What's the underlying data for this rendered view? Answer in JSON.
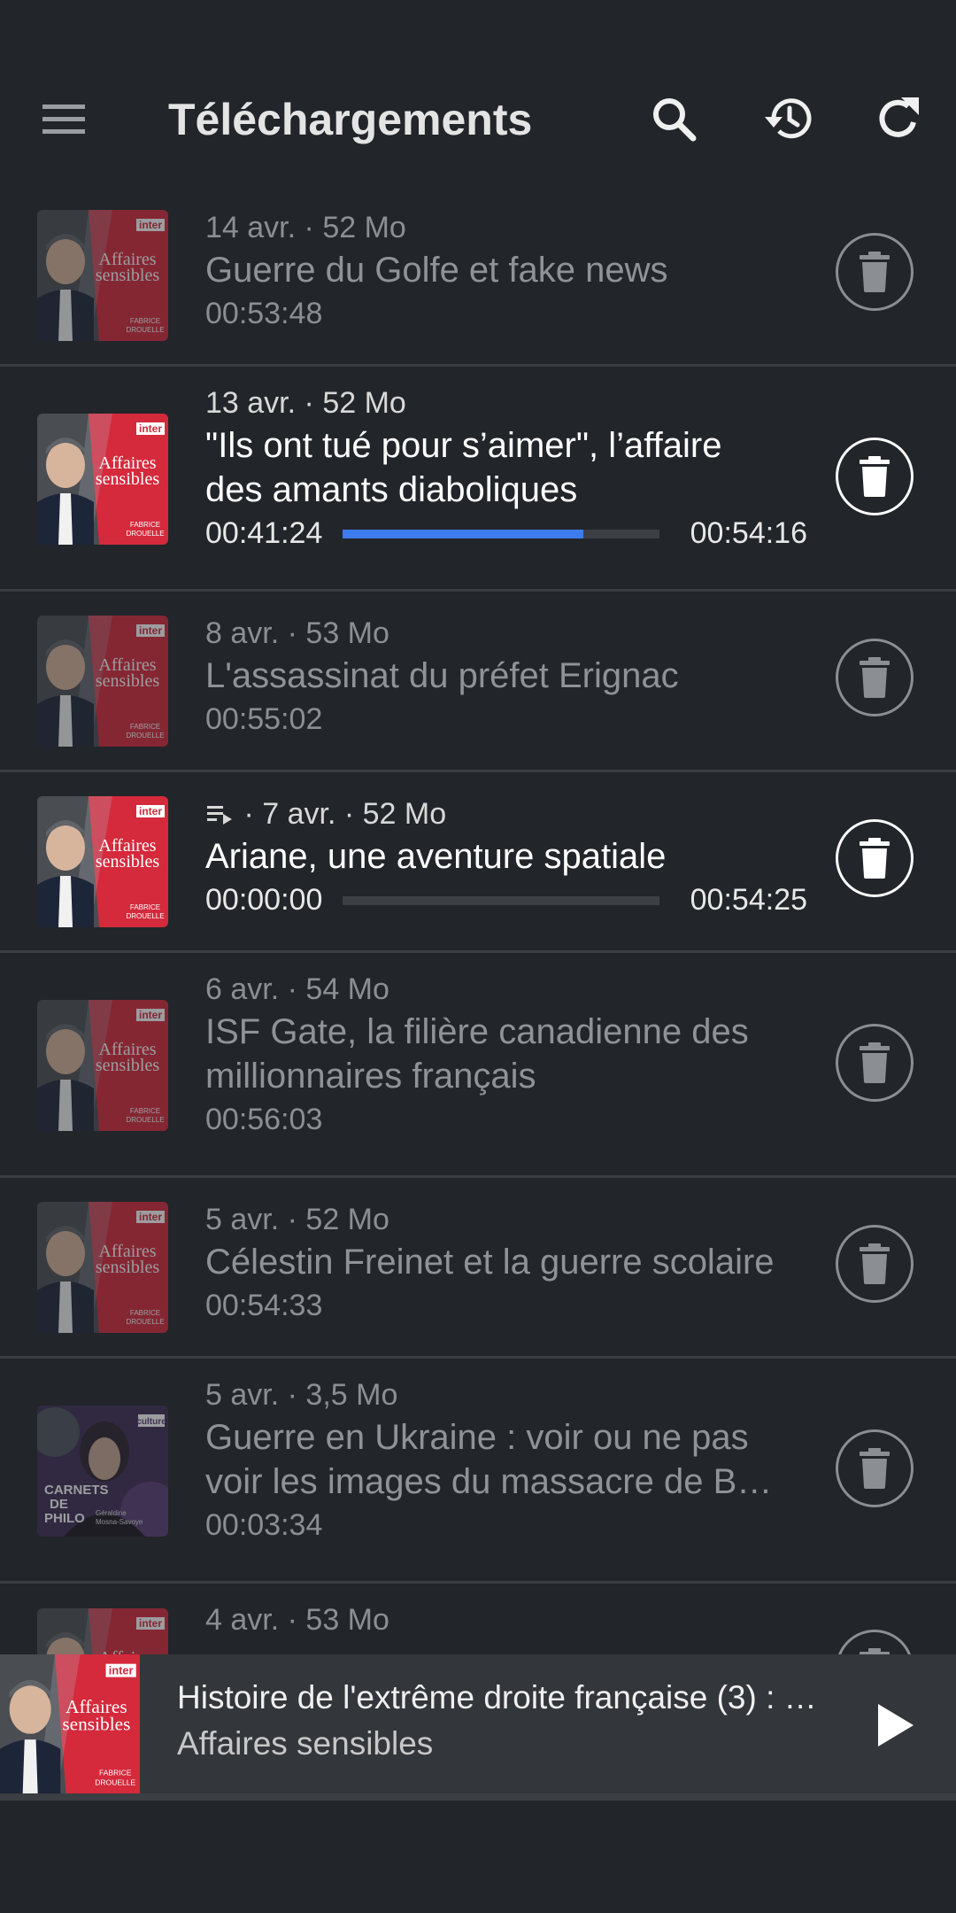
{
  "appbar": {
    "title": "Téléchargements",
    "menu_icon": "menu-icon",
    "search_icon": "search-icon",
    "history_icon": "history-icon",
    "refresh_icon": "refresh-icon"
  },
  "colors": {
    "background": "#22252a",
    "divider": "#3a3d42",
    "accent_progress": "#3d7bef",
    "muted_text": "#8b8e93",
    "cover_red": "#d42a3c",
    "cover_purple": "#5b3a78"
  },
  "episodes": [
    {
      "date": "14 avr.",
      "size": "52 Mo",
      "title": "Guerre du Golfe et fake news",
      "duration": "00:53:48",
      "cover": {
        "brand": "inter",
        "l1": "Affaires",
        "l2": "sensibles",
        "host1": "FABRICE",
        "host2": "DROUELLE"
      }
    },
    {
      "date": "13 avr.",
      "size": "52 Mo",
      "title_line1": "\"Ils ont tué pour s’aimer\", l’affaire",
      "title_line2": "des amants diaboliques",
      "position": "00:41:24",
      "total": "00:54:16",
      "progress": 0.76,
      "cover": {
        "brand": "inter",
        "l1": "Affaires",
        "l2": "sensibles",
        "host1": "FABRICE",
        "host2": "DROUELLE"
      }
    },
    {
      "date": "8 avr.",
      "size": "53 Mo",
      "title": "L'assassinat du préfet Erignac",
      "duration": "00:55:02",
      "cover": {
        "brand": "inter",
        "l1": "Affaires",
        "l2": "sensibles",
        "host1": "FABRICE",
        "host2": "DROUELLE"
      }
    },
    {
      "date": "7 avr.",
      "size": "52 Mo",
      "queue_icon": "playlist-play-icon",
      "title": "Ariane, une aventure spatiale",
      "position": "00:00:00",
      "total": "00:54:25",
      "progress": 0.0,
      "cover": {
        "brand": "inter",
        "l1": "Affaires",
        "l2": "sensibles",
        "host1": "FABRICE",
        "host2": "DROUELLE"
      }
    },
    {
      "date": "6 avr.",
      "size": "54 Mo",
      "title_line1": "ISF Gate, la filière canadienne des",
      "title_line2": "millionnaires français",
      "duration": "00:56:03",
      "cover": {
        "brand": "inter",
        "l1": "Affaires",
        "l2": "sensibles",
        "host1": "FABRICE",
        "host2": "DROUELLE"
      }
    },
    {
      "date": "5 avr.",
      "size": "52 Mo",
      "title": "Célestin Freinet et la guerre scolaire",
      "duration": "00:54:33",
      "cover": {
        "brand": "inter",
        "l1": "Affaires",
        "l2": "sensibles",
        "host1": "FABRICE",
        "host2": "DROUELLE"
      }
    },
    {
      "date": "5 avr.",
      "size": "3,5 Mo",
      "title_line1": "Guerre en Ukraine : voir ou ne pas",
      "title_line2": "voir les images du massacre de B…",
      "duration": "00:03:34",
      "cover": {
        "brand": "culture",
        "l1": "CARNETS",
        "l2": "DE",
        "l3": "PHILO",
        "host1": "Géraldine",
        "host2": "Mosna-Savoye"
      }
    },
    {
      "date": "4 avr.",
      "size": "53 Mo",
      "cover": {
        "brand": "inter"
      }
    }
  ],
  "separator": "·",
  "delete_icon": "trash-icon",
  "player": {
    "title": "Histoire de l'extrême droite française (3) : 1…",
    "subtitle": "Affaires sensibles",
    "play_icon": "play-icon",
    "progress": 0.0,
    "cover": {
      "brand": "inter",
      "l1": "Affaires",
      "l2": "sensibles",
      "host1": "FABRICE",
      "host2": "DROUELLE"
    }
  }
}
